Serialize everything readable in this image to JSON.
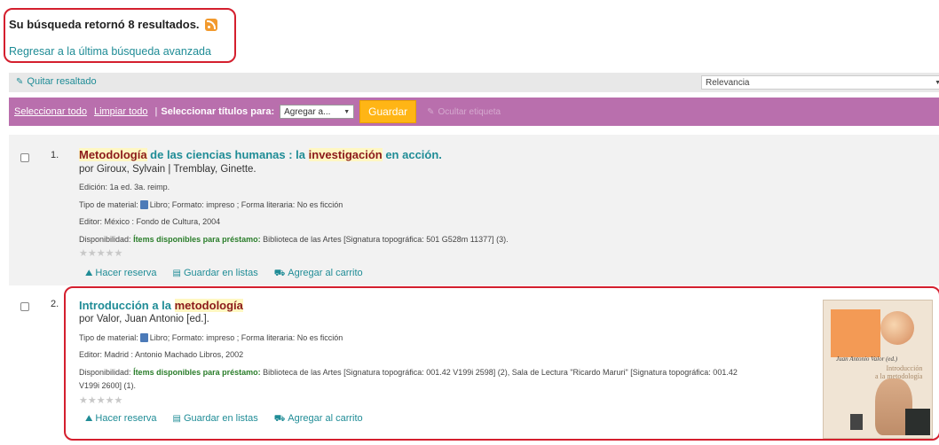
{
  "summary": {
    "text": "Su búsqueda retornó 8 resultados.",
    "back_link": "Regresar a la última búsqueda avanzada"
  },
  "toolbar": {
    "quitar_resaltado": "Quitar resaltado",
    "sort_value": "Relevancia",
    "seleccionar_todo": "Seleccionar todo",
    "limpiar_todo": "Limpiar todo",
    "separator": "|",
    "seleccionar_titulos": "Seleccionar títulos para:",
    "add_value": "Agregar a...",
    "guardar": "Guardar",
    "ocultar": "Ocultar etiqueta"
  },
  "results": [
    {
      "num": "1.",
      "title_parts": [
        "Metodología",
        " de las ciencias humanas : la ",
        "investigación",
        " en acción."
      ],
      "author": "por Giroux, Sylvain | Tremblay, Ginette.",
      "edicion_label": "Edición:",
      "edicion": "1a ed. 3a. reimp.",
      "tipo_label": "Tipo de material:",
      "tipo": "Libro; Formato: impreso ; Forma literaria: No es ficción",
      "editor_label": "Editor:",
      "editor": "México : Fondo de Cultura, 2004",
      "disp_label": "Disponibilidad:",
      "disp_items": "Ítems disponibles para préstamo:",
      "disp": "Biblioteca de las Artes [Signatura topográfica: 501 G528m 11377] (3).",
      "stars": "★★★★★",
      "actions": [
        "Hacer reserva",
        "Guardar en listas",
        "Agregar al carrito"
      ]
    },
    {
      "num": "2.",
      "title_parts": [
        "Introducción a la ",
        "metodología"
      ],
      "author": "por Valor, Juan Antonio [ed.].",
      "tipo_label": "Tipo de material:",
      "tipo": "Libro; Formato: impreso ; Forma literaria: No es ficción",
      "editor_label": "Editor:",
      "editor": "Madrid : Antonio Machado Libros, 2002",
      "disp_label": "Disponibilidad:",
      "disp_items": "Ítems disponibles para préstamo:",
      "disp_line1": "Biblioteca de las Artes [Signatura topográfica: 001.42 V199i 2598] (2), Sala de Lectura \"Ricardo Maruri\" [Signatura topográfica: 001.42",
      "disp_line2": "V199i 2600] (1).",
      "stars": "★★★★★",
      "actions": [
        "Hacer reserva",
        "Guardar en listas",
        "Agregar al carrito"
      ],
      "cover": {
        "author": "Juan Antonio Valor (ed.)",
        "title_line1": "Introducción",
        "title_line2": "a la metodología"
      }
    }
  ]
}
